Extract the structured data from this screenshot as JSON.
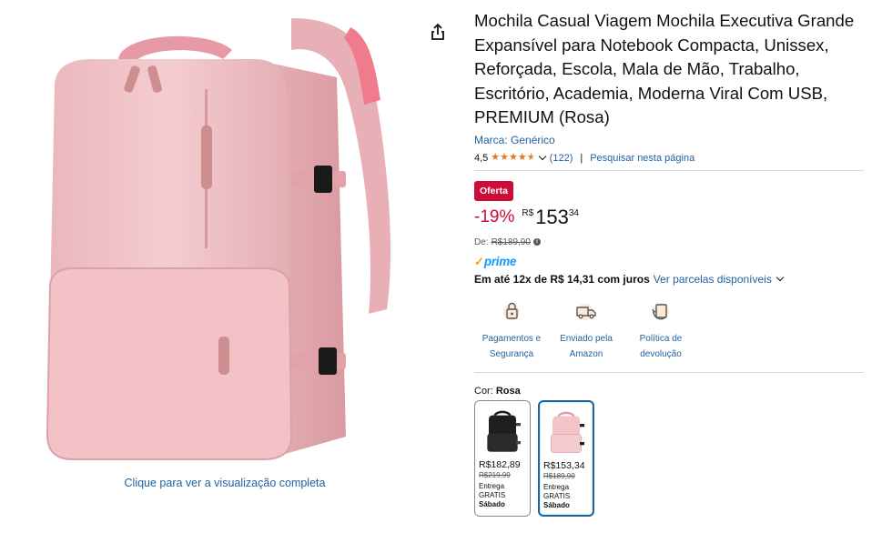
{
  "product": {
    "title": "Mochila Casual Viagem Mochila Executiva Grande Expansível para Notebook Compacta, Unissex, Reforçada, Escola, Mala de Mão, Trabalho, Escritório, Academia, Moderna Viral Com USB, PREMIUM (Rosa)",
    "brand": "Marca: Genérico",
    "rating": "4,5",
    "rating_value": 4.5,
    "review_count": "(122)",
    "search_page": "Pesquisar nesta página"
  },
  "image": {
    "zoom_link": "Clique para ver a visualização completa",
    "share_icon": "share-icon"
  },
  "pricing": {
    "deal_badge": "Oferta",
    "discount": "-19%",
    "currency": "R$",
    "whole": "153",
    "fraction": "34",
    "list_label": "De:",
    "list_price": "R$189,90",
    "installments_bold": "Em até 12x de R$ 14,31 com juros",
    "installments_link": "Ver parcelas disponíveis"
  },
  "prime": {
    "check": "✓",
    "label": "prime"
  },
  "features": [
    {
      "label": "Pagamentos e Segurança",
      "icon": "secure-payment-icon"
    },
    {
      "label": "Enviado pela Amazon",
      "icon": "delivery-truck-icon"
    },
    {
      "label": "Política de devolução",
      "icon": "return-policy-icon"
    }
  ],
  "variations": {
    "label": "Cor:",
    "selected": "Rosa",
    "options": [
      {
        "price": "R$182,89",
        "old_price": "R$219,99",
        "ship1": "Entrega",
        "ship2": "GRATIS",
        "day": "Sábado",
        "color": "black"
      },
      {
        "price": "R$153,34",
        "old_price": "R$189,90",
        "ship1": "Entrega",
        "ship2": "GRATIS",
        "day": "Sábado",
        "color": "pink"
      }
    ]
  },
  "colors": {
    "link": "#2162a1",
    "deal": "#cc0c39",
    "star": "#de7921",
    "prime": "#1399ff",
    "pink_bag": "#f2c4c8",
    "black_bag": "#1f1f1f"
  }
}
